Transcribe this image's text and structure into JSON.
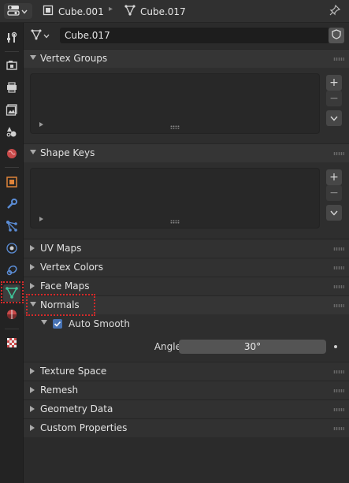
{
  "header": {
    "object_name": "Cube.001",
    "mesh_name": "Cube.017",
    "editor_type_icon": "properties-editor-icon",
    "pin_icon": "pin-icon"
  },
  "tabs": [
    {
      "name": "tool",
      "icon": "tool-wrench-screwdriver-icon"
    },
    {
      "name": "render",
      "icon": "camera-back-icon"
    },
    {
      "name": "output",
      "icon": "printer-icon"
    },
    {
      "name": "view-layer",
      "icon": "image-stack-icon"
    },
    {
      "name": "scene",
      "icon": "scene-cone-sphere-icon"
    },
    {
      "name": "world",
      "icon": "world-globe-icon"
    },
    {
      "name": "object",
      "icon": "object-square-icon"
    },
    {
      "name": "modifiers",
      "icon": "wrench-icon"
    },
    {
      "name": "particles",
      "icon": "particles-icon"
    },
    {
      "name": "physics",
      "icon": "physics-orbit-icon"
    },
    {
      "name": "constraints",
      "icon": "constraints-icon"
    },
    {
      "name": "data",
      "icon": "mesh-data-triangle-icon",
      "active": true
    },
    {
      "name": "material",
      "icon": "material-sphere-icon"
    },
    {
      "name": "texture",
      "icon": "texture-checker-icon"
    }
  ],
  "data_block": {
    "mesh_name": "Cube.017"
  },
  "panels": {
    "vertex_groups": {
      "label": "Vertex Groups",
      "add": "+",
      "remove": "−"
    },
    "shape_keys": {
      "label": "Shape Keys",
      "add": "+",
      "remove": "−"
    },
    "uv_maps": {
      "label": "UV Maps"
    },
    "vertex_colors": {
      "label": "Vertex Colors"
    },
    "face_maps": {
      "label": "Face Maps"
    },
    "normals": {
      "label": "Normals",
      "auto_smooth_label": "Auto Smooth",
      "auto_smooth_checked": true,
      "angle_label": "Angle",
      "angle_value": "30°"
    },
    "texture_space": {
      "label": "Texture Space"
    },
    "remesh": {
      "label": "Remesh"
    },
    "geometry_data": {
      "label": "Geometry Data"
    },
    "custom_properties": {
      "label": "Custom Properties"
    }
  },
  "colors": {
    "accent_blue": "#4772b3",
    "highlight_red": "#d42a2a",
    "data_tab_green": "#3ec79b"
  }
}
